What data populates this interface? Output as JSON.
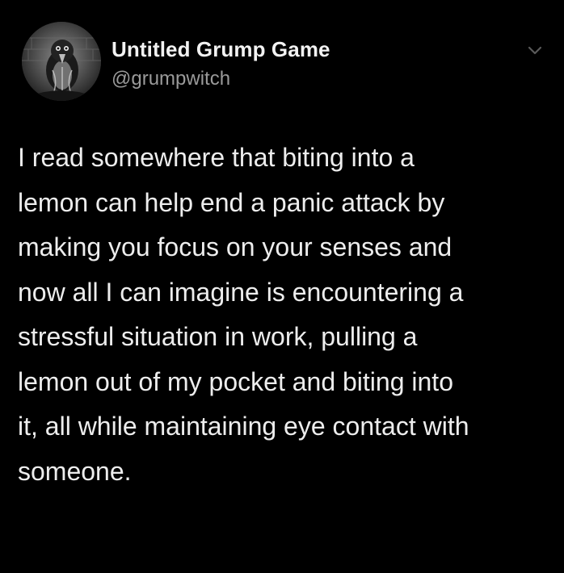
{
  "tweet": {
    "display_name": "Untitled Grump Game",
    "handle": "@grumpwitch",
    "avatar_icon": "avatar-crow-image",
    "menu_icon": "chevron-down-icon",
    "text_lines": [
      "I read somewhere that biting into a",
      "lemon can help end a panic attack by",
      "making you focus on your senses and",
      "now all I can imagine is encountering a",
      "stressful situation in work, pulling a",
      "lemon out of my pocket and biting into",
      "it, all while maintaining eye contact with",
      "someone."
    ]
  },
  "colors": {
    "background": "#000000",
    "name": "#f2f2f2",
    "handle": "#9a9a9a",
    "body_text": "#ededed",
    "chevron": "#5a5a5a"
  }
}
